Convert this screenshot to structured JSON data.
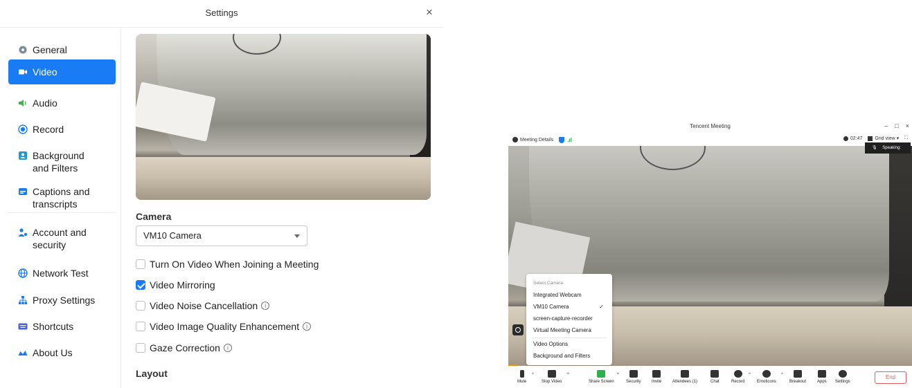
{
  "settings": {
    "title": "Settings",
    "close_glyph": "×",
    "sidebar": {
      "items": [
        {
          "label": "General",
          "icon": "gear-icon"
        },
        {
          "label": "Video",
          "icon": "video-camera-icon",
          "active": true
        },
        {
          "label": "Audio",
          "icon": "speaker-icon"
        },
        {
          "label": "Record",
          "icon": "record-icon"
        },
        {
          "label": "Background\nand Filters",
          "icon": "background-icon"
        },
        {
          "label": "Captions and\ntranscripts",
          "icon": "captions-icon"
        },
        {
          "label": "Account and\nsecurity",
          "icon": "account-icon"
        },
        {
          "label": "Network Test",
          "icon": "globe-icon"
        },
        {
          "label": "Proxy Settings",
          "icon": "network-icon"
        },
        {
          "label": "Shortcuts",
          "icon": "keyboard-icon"
        },
        {
          "label": "About Us",
          "icon": "about-icon"
        }
      ]
    },
    "camera_section_title": "Camera",
    "camera_selected": "VM10 Camera",
    "options": [
      {
        "label": "Turn On Video When Joining a Meeting",
        "checked": false,
        "info": false
      },
      {
        "label": "Video Mirroring",
        "checked": true,
        "info": false
      },
      {
        "label": "Video Noise Cancellation",
        "checked": false,
        "info": true
      },
      {
        "label": "Video Image Quality Enhancement",
        "checked": false,
        "info": true
      },
      {
        "label": "Gaze Correction",
        "checked": false,
        "info": true
      }
    ],
    "layout_section_title": "Layout",
    "accent_color": "#1a7cf5"
  },
  "meeting": {
    "title": "Tencent Meeting",
    "window_controls": [
      "–",
      "□",
      "×"
    ],
    "meeting_details_label": "Meeting Details",
    "timer": "02:47",
    "view_label": "Grid view",
    "speaking_label": "Speaking:",
    "camera_menu": {
      "header": "Select Camera",
      "cameras": [
        {
          "label": "Integrated Webcam",
          "selected": false
        },
        {
          "label": "VM10 Camera",
          "selected": true
        },
        {
          "label": "screen-capture-recorder",
          "selected": false
        },
        {
          "label": "Virtual Meeting Camera",
          "selected": false
        }
      ],
      "actions": [
        "Video Options",
        "Background and Filters"
      ],
      "check_glyph": "✓"
    },
    "toolbar": [
      {
        "label": "Mute",
        "icon": "microphone-icon"
      },
      {
        "label": "Stop Video",
        "icon": "video-camera-icon"
      },
      {
        "label": "Share Screen",
        "icon": "share-screen-icon"
      },
      {
        "label": "Security",
        "icon": "shield-icon"
      },
      {
        "label": "Invite",
        "icon": "invite-icon"
      },
      {
        "label": "Attendees (1)",
        "icon": "attendees-icon"
      },
      {
        "label": "Chat",
        "icon": "chat-icon"
      },
      {
        "label": "Record",
        "icon": "record-icon"
      },
      {
        "label": "Emoticons",
        "icon": "emoticons-icon"
      },
      {
        "label": "Breakout",
        "icon": "breakout-icon"
      },
      {
        "label": "Apps",
        "icon": "apps-icon"
      },
      {
        "label": "Settings",
        "icon": "gear-icon"
      }
    ],
    "end_label": "End",
    "end_color": "#e25c5c"
  }
}
